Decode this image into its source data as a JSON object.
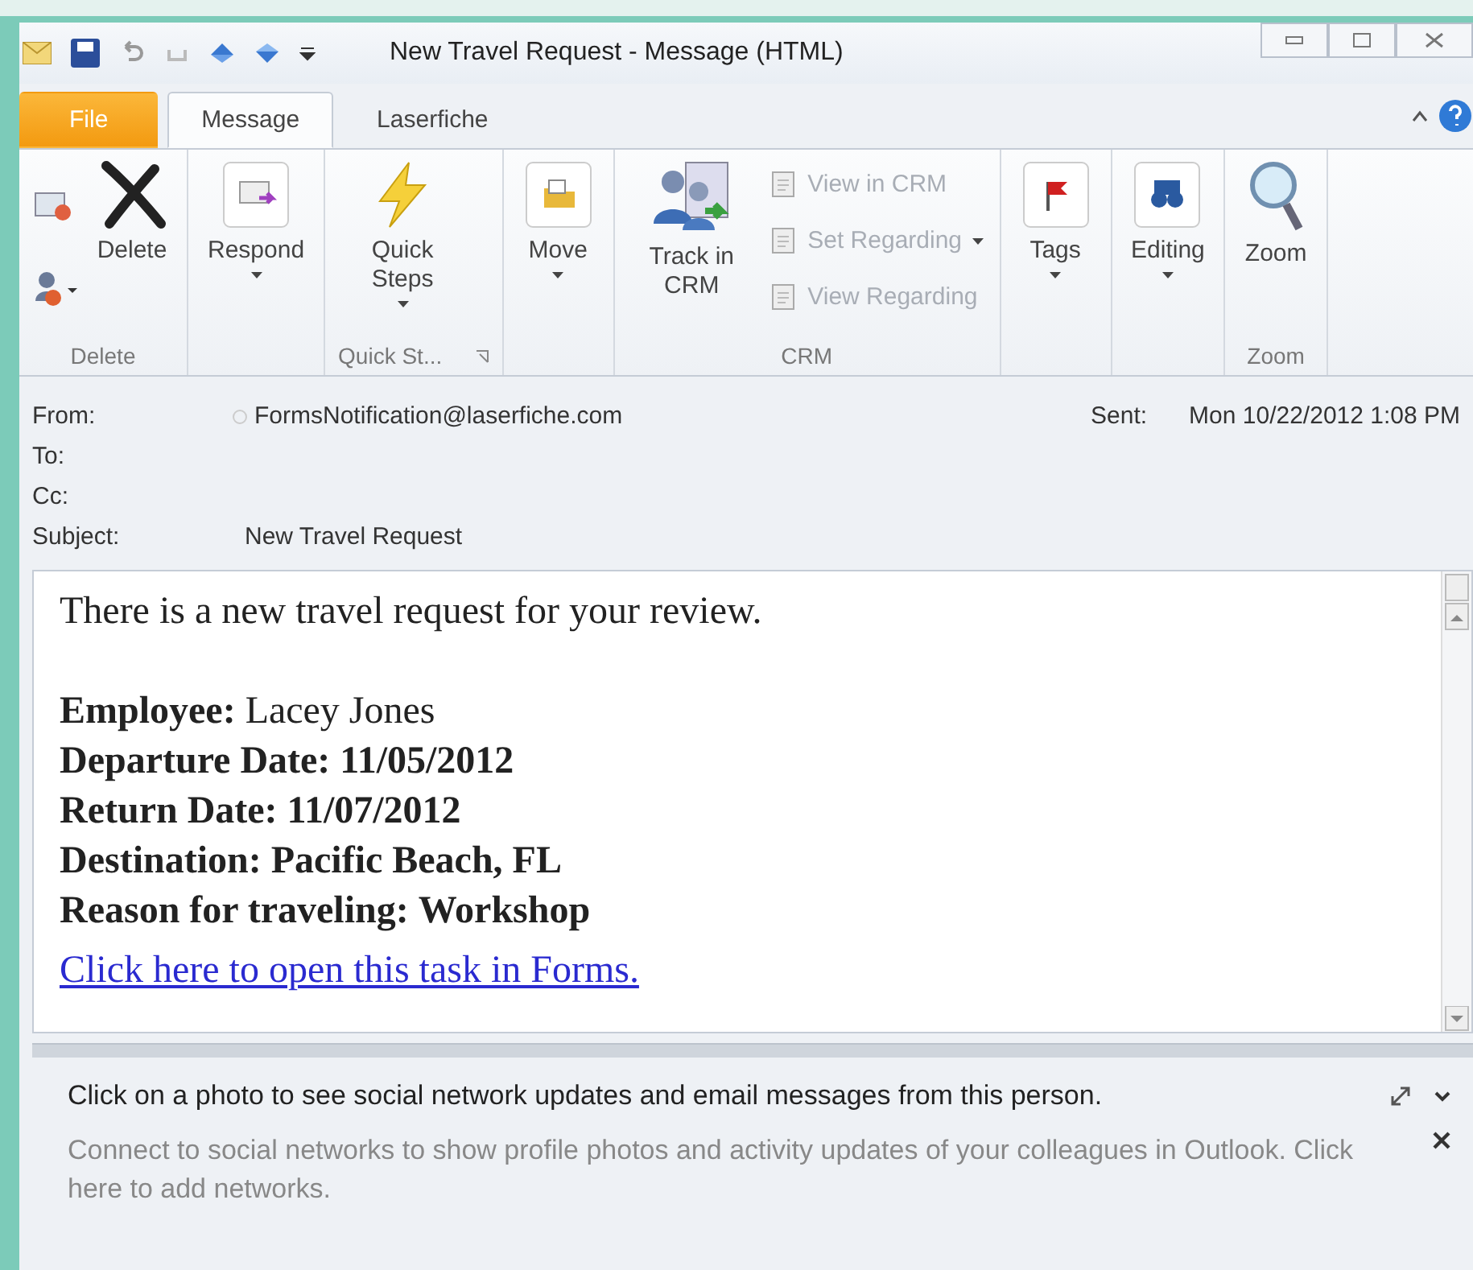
{
  "window": {
    "title": "New Travel Request - Message (HTML)"
  },
  "tabs": [
    {
      "label": "File",
      "kind": "file",
      "selected": false
    },
    {
      "label": "Message",
      "kind": "tab",
      "selected": true
    },
    {
      "label": "Laserfiche",
      "kind": "tab",
      "selected": false
    }
  ],
  "ribbon": [
    {
      "label": "Delete",
      "buttons": [
        {
          "kind": "small-stack"
        },
        {
          "kind": "large",
          "label": "Delete",
          "dropdown": false
        }
      ]
    },
    {
      "buttons": [
        {
          "kind": "large",
          "label": "Respond",
          "dropdown": true
        }
      ]
    },
    {
      "label": "Quick St...",
      "launcher": true,
      "buttons": [
        {
          "kind": "large",
          "label": "Quick Steps",
          "dropdown": true
        }
      ]
    },
    {
      "buttons": [
        {
          "kind": "large",
          "label": "Move",
          "dropdown": true
        }
      ]
    },
    {
      "label": "CRM",
      "buttons": [
        {
          "kind": "large",
          "label": "Track in CRM",
          "dropdown": false
        },
        {
          "kind": "small",
          "label": "View in CRM",
          "disabled": true,
          "dropdown": false
        },
        {
          "kind": "small",
          "label": "Set Regarding",
          "disabled": true,
          "dropdown": true
        },
        {
          "kind": "small",
          "label": "View Regarding",
          "disabled": true,
          "dropdown": false
        }
      ]
    },
    {
      "buttons": [
        {
          "kind": "large",
          "label": "Tags",
          "dropdown": true
        }
      ]
    },
    {
      "buttons": [
        {
          "kind": "large",
          "label": "Editing",
          "dropdown": true
        }
      ]
    },
    {
      "label": "Zoom",
      "buttons": [
        {
          "kind": "large",
          "label": "Zoom",
          "dropdown": false
        }
      ]
    }
  ],
  "header": {
    "from_label": "From:",
    "from": "FormsNotification@laserfiche.com",
    "sent_label": "Sent:",
    "sent": "Mon 10/22/2012 1:08 PM",
    "to_label": "To:",
    "cc_label": "Cc:",
    "subject_label": "Subject:",
    "subject": "New Travel Request"
  },
  "body": {
    "intro": "There is a new travel request for your review.",
    "fields": [
      {
        "label": "Employee:",
        "value": "Lacey Jones",
        "bold_value": false
      },
      {
        "label": "Departure Date:",
        "value": "11/05/2012",
        "bold_value": true
      },
      {
        "label": "Return Date:",
        "value": "11/07/2012",
        "bold_value": true
      },
      {
        "label": "Destination:",
        "value": "Pacific Beach, FL",
        "bold_value": true
      },
      {
        "label": "Reason for traveling:",
        "value": "Workshop",
        "bold_value": true
      }
    ],
    "link": "Click here to open this task in Forms."
  },
  "social_pane": {
    "message": "Click on a photo to see social network updates and email messages from this person.",
    "connect": "Connect to social networks to show profile photos and activity updates of your colleagues in Outlook. Click here to add networks."
  }
}
